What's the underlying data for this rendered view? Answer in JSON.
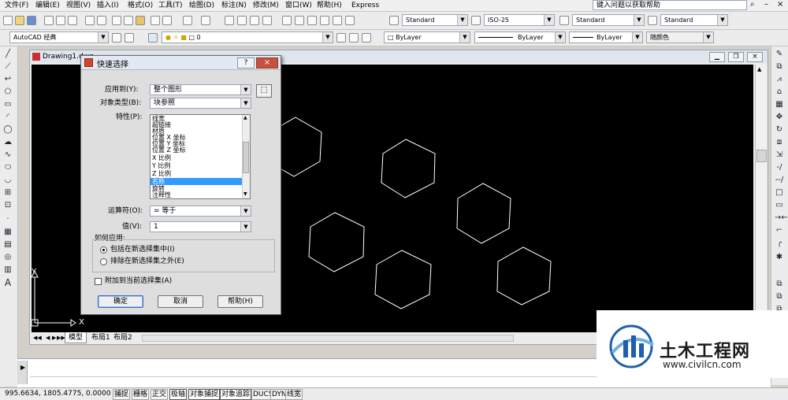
{
  "menu": {
    "items": [
      "文件(F)",
      "编辑(E)",
      "视图(V)",
      "插入(I)",
      "格式(O)",
      "工具(T)",
      "绘图(D)",
      "标注(N)",
      "修改(M)",
      "窗口(W)",
      "帮助(H)",
      "Express"
    ],
    "help_search": "键入问题以获取帮助"
  },
  "toolbar": {
    "text_style": "Standard",
    "dim_style": "ISO-25",
    "table_style": "Standard",
    "multileader_style": "Standard",
    "workspace": "AutoCAD 经典",
    "layer": "0",
    "color": "ByLayer",
    "linetype": "ByLayer",
    "lineweight": "ByLayer",
    "plotstyle": "随颜色"
  },
  "drawing": {
    "title": "Drawing1.dwg",
    "tabs": [
      "模型",
      "布局1",
      "布局2"
    ],
    "axis_x": "X",
    "axis_y": "Y"
  },
  "dialog": {
    "title": "快速选择",
    "help_q": "?",
    "close": "×",
    "apply_to_label": "应用到(Y):",
    "apply_to_value": "整个图形",
    "object_type_label": "对象类型(B):",
    "object_type_value": "块参照",
    "properties_label": "特性(P):",
    "properties": [
      "线宽",
      "超链接",
      "材质",
      "位置 X 坐标",
      "位置 Y 坐标",
      "位置 Z 坐标",
      "X 比例",
      "Y 比例",
      "Z 比例",
      "名称",
      "旋转",
      "注释性"
    ],
    "operator_label": "运算符(O):",
    "operator_value": "= 等于",
    "value_label": "值(V):",
    "value_value": "1",
    "how_apply_label": "如何应用:",
    "include_option": "包括在新选择集中(I)",
    "exclude_option": "排除在新选择集之外(E)",
    "append_label": "附加到当前选择集(A)",
    "ok": "确定",
    "cancel": "取消",
    "help": "帮助(H)"
  },
  "status": {
    "coords": "995.6634,  1805.4775, 0.0000",
    "buttons": [
      "捕捉",
      "栅格",
      "正交",
      "极轴",
      "对象捕捉",
      "对象追踪",
      "DUCS",
      "DYN",
      "线宽"
    ]
  },
  "watermark": {
    "name": "土木工程网",
    "url": "www.civilcn.com"
  },
  "colors": {
    "canvas": "#000000",
    "hexagon": "#ffffff",
    "selection": "#3399ff",
    "watermark_blue": "#1f5fae"
  }
}
